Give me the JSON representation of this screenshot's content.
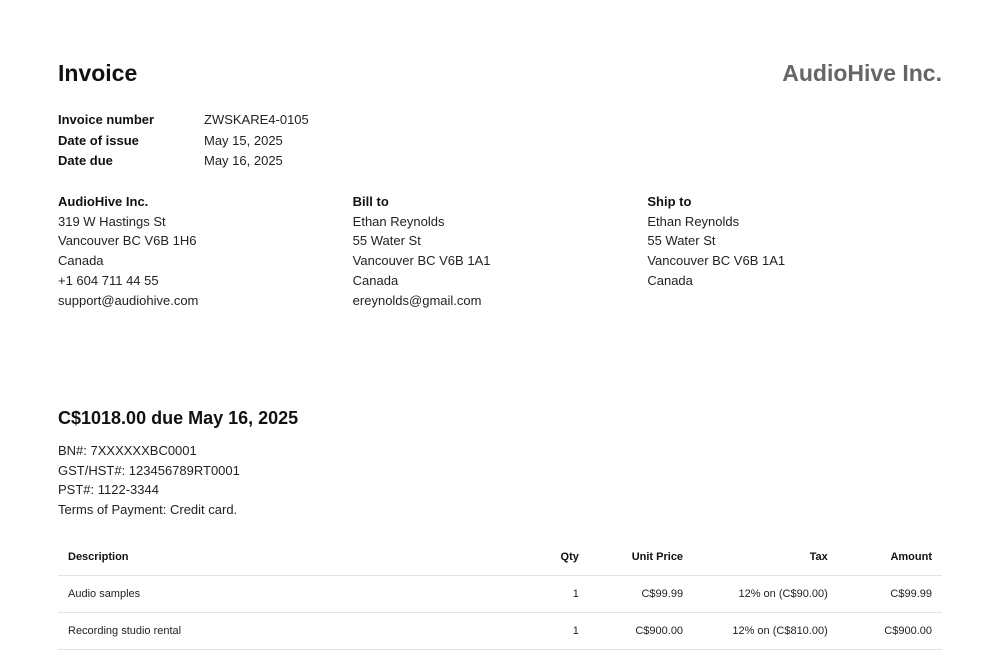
{
  "invoice": {
    "title": "Invoice",
    "company_logo_text": "AudioHive Inc.",
    "meta": [
      {
        "label": "Invoice number",
        "value": "ZWSKARE4-0105"
      },
      {
        "label": "Date of issue",
        "value": "May 15, 2025"
      },
      {
        "label": "Date due",
        "value": "May 16, 2025"
      }
    ],
    "from": {
      "heading": "AudioHive Inc.",
      "lines": [
        "319 W Hastings St",
        "Vancouver BC V6B 1H6",
        "Canada",
        "+1 604 711 44 55",
        "support@audiohive.com"
      ]
    },
    "bill_to": {
      "heading": "Bill to",
      "lines": [
        "Ethan Reynolds",
        "55 Water St",
        "Vancouver BC V6B 1A1",
        "Canada",
        "ereynolds@gmail.com"
      ]
    },
    "ship_to": {
      "heading": "Ship to",
      "lines": [
        "Ethan Reynolds",
        "55 Water St",
        "Vancouver BC V6B 1A1",
        "Canada"
      ]
    },
    "due_heading": "C$1018.00 due May 16, 2025",
    "notes": [
      "BN#: 7XXXXXXBC0001",
      "GST/HST#: 123456789RT0001",
      "PST#: 1122-3344",
      "Terms of Payment: Credit card."
    ],
    "table": {
      "headers": {
        "description": "Description",
        "qty": "Qty",
        "unit_price": "Unit Price",
        "tax": "Tax",
        "amount": "Amount"
      },
      "rows": [
        {
          "description": "Audio samples",
          "qty": "1",
          "unit_price": "C$99.99",
          "tax": "12% on (C$90.00)",
          "amount": "C$99.99"
        },
        {
          "description": "Recording studio rental",
          "qty": "1",
          "unit_price": "C$900.00",
          "tax": "12% on (C$810.00)",
          "amount": "C$900.00"
        }
      ]
    }
  }
}
